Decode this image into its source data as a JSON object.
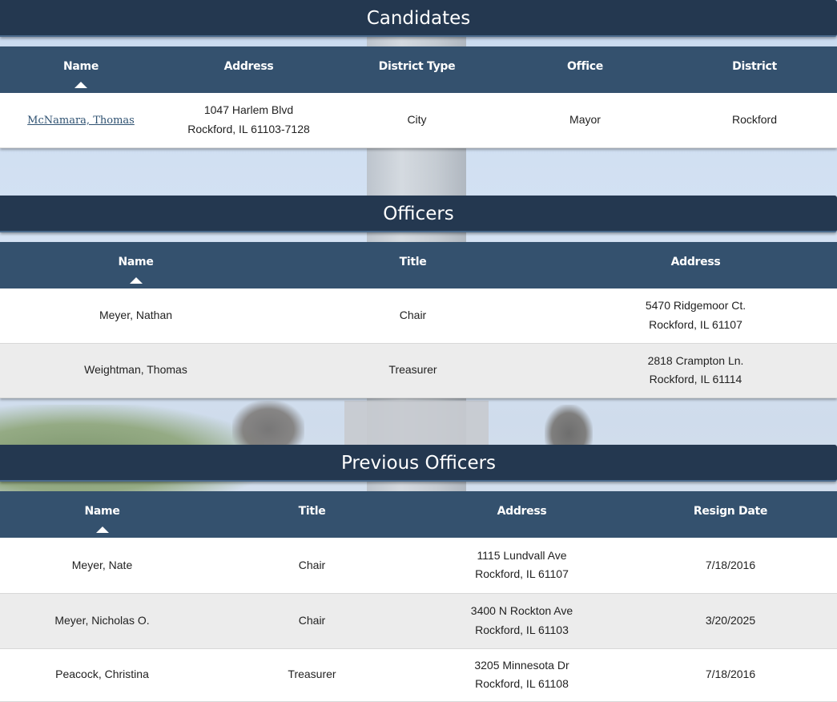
{
  "candidates": {
    "title": "Candidates",
    "columns": [
      "Name",
      "Address",
      "District Type",
      "Office",
      "District"
    ],
    "rows": [
      {
        "name": "McNamara, Thomas",
        "address_line1": "1047 Harlem Blvd",
        "address_line2": "Rockford, IL 61103-7128",
        "district_type": "City",
        "office": "Mayor",
        "district": "Rockford"
      }
    ]
  },
  "officers": {
    "title": "Officers",
    "columns": [
      "Name",
      "Title",
      "Address"
    ],
    "rows": [
      {
        "name": "Meyer, Nathan",
        "title": "Chair",
        "address_line1": "5470 Ridgemoor Ct.",
        "address_line2": "Rockford, IL 61107"
      },
      {
        "name": "Weightman, Thomas",
        "title": "Treasurer",
        "address_line1": "2818 Crampton Ln.",
        "address_line2": "Rockford, IL 61114"
      }
    ]
  },
  "previous_officers": {
    "title": "Previous Officers",
    "columns": [
      "Name",
      "Title",
      "Address",
      "Resign Date"
    ],
    "rows": [
      {
        "name": "Meyer, Nate",
        "title": "Chair",
        "address_line1": "1115 Lundvall Ave",
        "address_line2": "Rockford, IL 61107",
        "resign_date": "7/18/2016"
      },
      {
        "name": "Meyer, Nicholas O.",
        "title": "Chair",
        "address_line1": "3400 N Rockton Ave",
        "address_line2": "Rockford, IL 61103",
        "resign_date": "3/20/2025"
      },
      {
        "name": "Peacock, Christina",
        "title": "Treasurer",
        "address_line1": "3205 Minnesota Dr",
        "address_line2": "Rockford, IL 61108",
        "resign_date": "7/18/2016"
      }
    ]
  },
  "sort_indicator": "ascending-arrow-icon",
  "colors": {
    "section_bar": "#243850",
    "table_header": "#34516e",
    "link": "#2f5272",
    "row_alt": "#ececec"
  }
}
